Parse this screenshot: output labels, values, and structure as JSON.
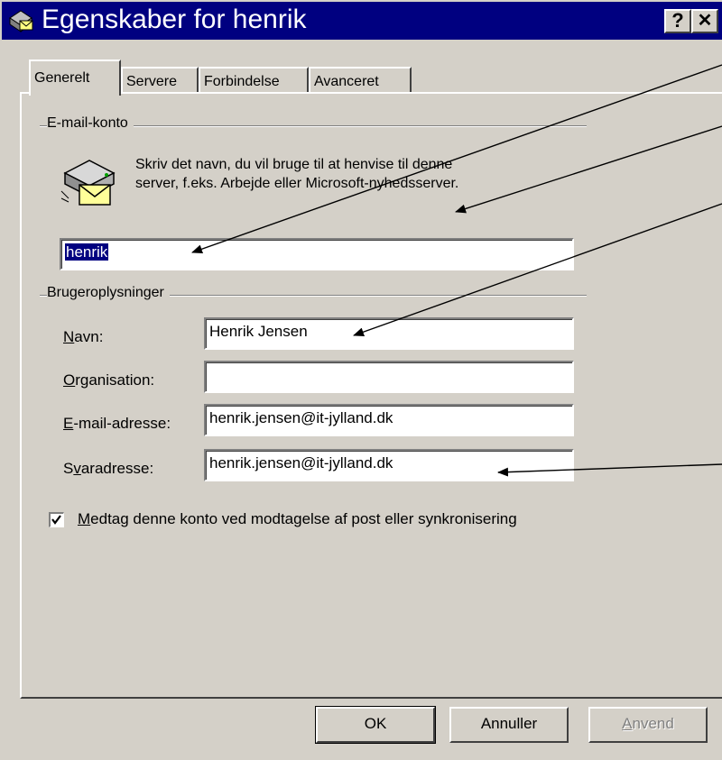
{
  "window": {
    "title": "Egenskaber for henrik",
    "help_glyph": "?",
    "close_glyph": "✕",
    "title_icon": "mail-account-icon"
  },
  "tabs": [
    {
      "label": "Generelt",
      "active": true
    },
    {
      "label": "Servere",
      "active": false
    },
    {
      "label": "Forbindelse",
      "active": false
    },
    {
      "label": "Avanceret",
      "active": false
    }
  ],
  "email_account": {
    "group_label": "E-mail-konto",
    "icon": "mail-server-icon",
    "description_line1": "Skriv det navn, du vil bruge til at henvise til denne",
    "description_line2": "server, f.eks. Arbejde eller Microsoft-nyhedsserver.",
    "account_name": "henrik"
  },
  "user_info": {
    "group_label": "Brugeroplysninger",
    "fields": [
      {
        "label": "Navn:",
        "mnemonic": "N",
        "value": "Henrik Jensen"
      },
      {
        "label": "Organisation:",
        "mnemonic": "O",
        "value": ""
      },
      {
        "label": "E-mail-adresse:",
        "mnemonic": "E",
        "value": "henrik.jensen@it-jylland.dk"
      },
      {
        "label": "Svaradresse:",
        "mnemonic": "v",
        "value": "henrik.jensen@it-jylland.dk"
      }
    ]
  },
  "include_checkbox": {
    "label": "Medtag denne konto ved modtagelse af post eller synkronisering",
    "checked": true
  },
  "buttons": {
    "ok": "OK",
    "cancel": "Annuller",
    "apply": "Anvend"
  },
  "colors": {
    "title_bar": "#000080",
    "dialog_face": "#d4d0c8",
    "selection": "#000080"
  }
}
